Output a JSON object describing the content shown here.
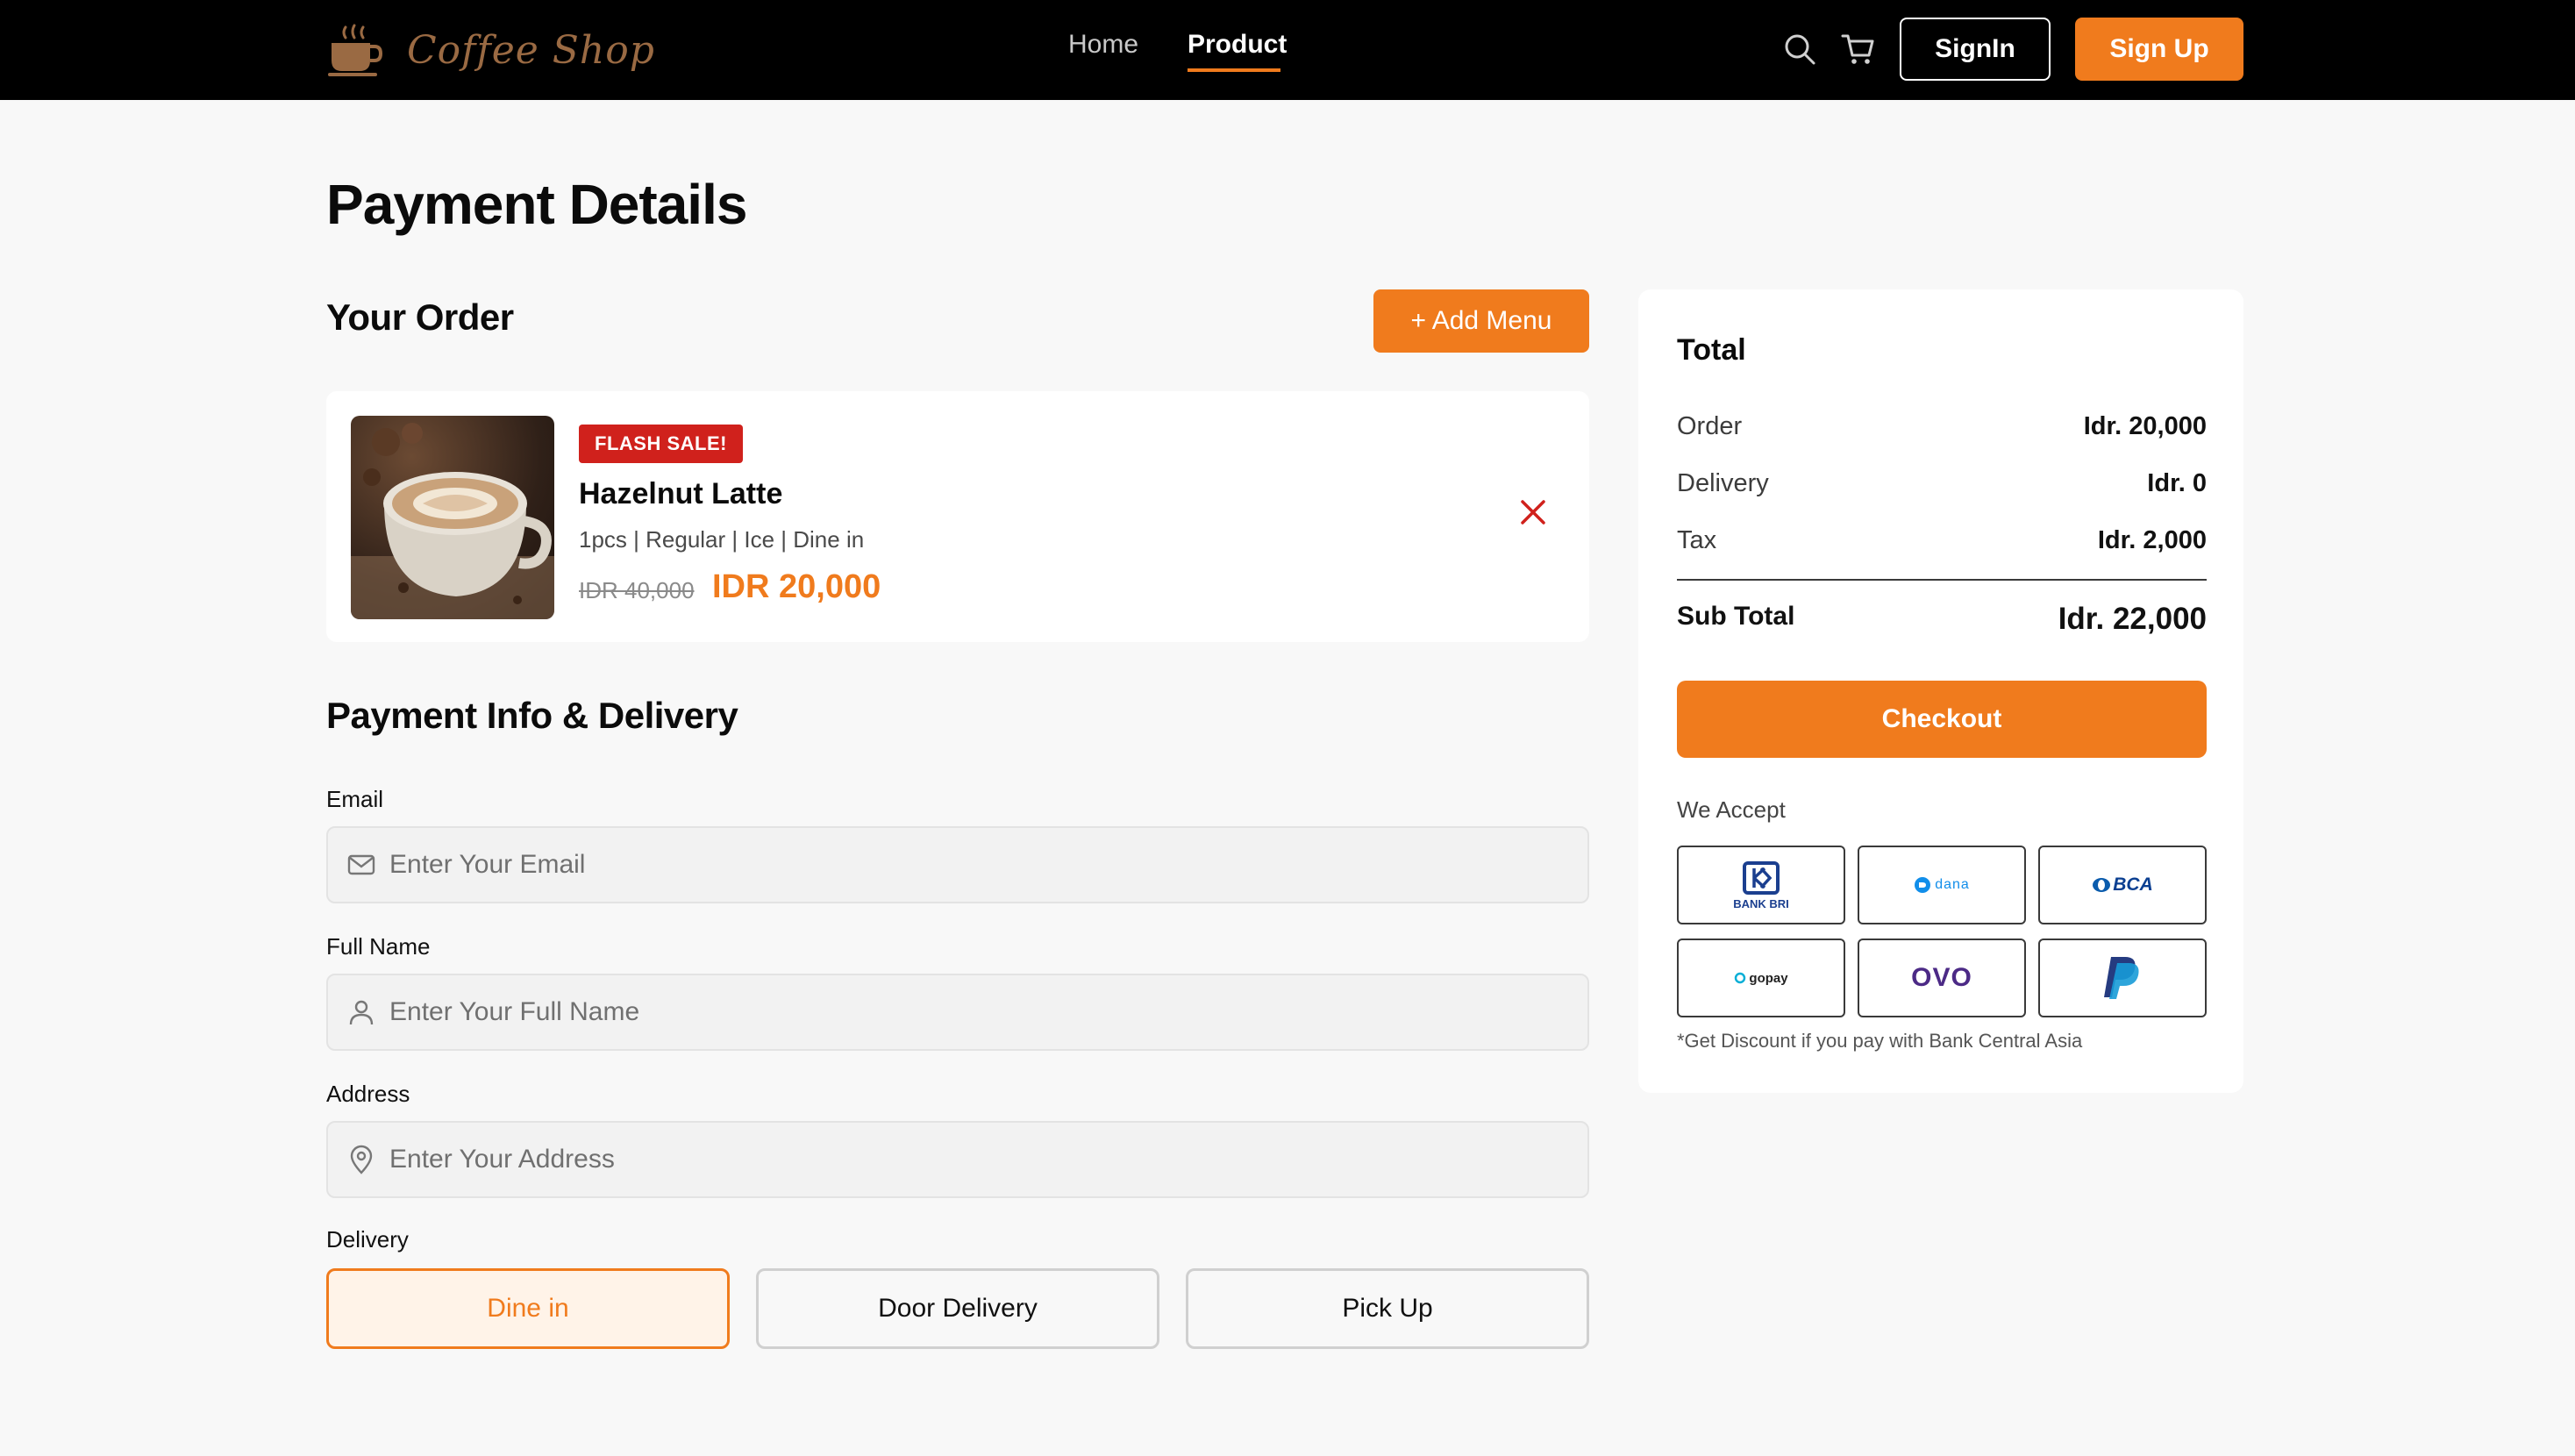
{
  "nav": {
    "brand": "Coffee Shop",
    "links": [
      "Home",
      "Product"
    ],
    "signin_label": "SignIn",
    "signup_label": "Sign Up"
  },
  "page_title": "Payment Details",
  "order": {
    "title": "Your Order",
    "add_menu_label": "+ Add Menu",
    "item": {
      "badge": "FLASH SALE!",
      "name": "Hazelnut Latte",
      "detail": "1pcs | Regular | Ice | Dine in",
      "old_price": "IDR 40,000",
      "price": "IDR 20,000"
    }
  },
  "payment": {
    "title": "Payment Info & Delivery",
    "email": {
      "label": "Email",
      "placeholder": "Enter Your Email"
    },
    "full_name": {
      "label": "Full Name",
      "placeholder": "Enter Your Full Name"
    },
    "address": {
      "label": "Address",
      "placeholder": "Enter Your Address"
    },
    "delivery": {
      "label": "Delivery",
      "options": [
        "Dine in",
        "Door Delivery",
        "Pick Up"
      ],
      "selected": "Dine in"
    }
  },
  "total": {
    "title": "Total",
    "rows": [
      {
        "label": "Order",
        "value": "Idr. 20,000"
      },
      {
        "label": "Delivery",
        "value": "Idr. 0"
      },
      {
        "label": "Tax",
        "value": "Idr. 2,000"
      }
    ],
    "subtotal": {
      "label": "Sub Total",
      "value": "Idr. 22,000"
    },
    "checkout_label": "Checkout",
    "accept_label": "We Accept",
    "methods": [
      "BANK BRI",
      "DANA",
      "BCA",
      "gopay",
      "OVO",
      "PayPal"
    ],
    "note": "*Get Discount if you pay with Bank Central Asia"
  },
  "colors": {
    "accent": "#f07b1d",
    "danger": "#d0211c",
    "navbar": "#000000"
  }
}
